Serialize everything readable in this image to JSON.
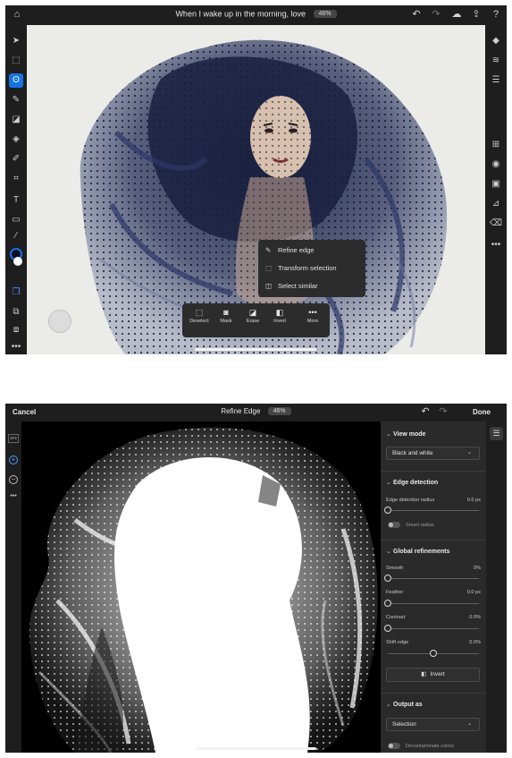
{
  "screen1": {
    "document_title": "When I wake up in the morning, love",
    "zoom": "46%",
    "left_tools": [
      "home-icon",
      "move-icon",
      "transform-icon",
      "lasso-icon",
      "brush-icon",
      "eraser-icon",
      "fill-icon",
      "healing-icon",
      "crop-icon",
      "type-icon",
      "place-image-icon",
      "eyedropper-icon",
      "color-swatch",
      "layers-select-icon",
      "mask-icon",
      "stack-icon",
      "more-icon"
    ],
    "right_tools": [
      "layers-icon",
      "layer-properties-icon",
      "adjustments-icon",
      "add-layer-icon",
      "visibility-icon",
      "mask-icon",
      "adjustment-layer-icon",
      "clear-icon",
      "more-icon"
    ],
    "context_menu": {
      "items": [
        {
          "icon": "refine-edge-icon",
          "label": "Refine edge"
        },
        {
          "icon": "transform-selection-icon",
          "label": "Transform selection"
        },
        {
          "icon": "select-similar-icon",
          "label": "Select similar"
        }
      ]
    },
    "bottom_bar": {
      "items": [
        {
          "icon": "deselect-icon",
          "label": "Deselect"
        },
        {
          "icon": "mask-icon",
          "label": "Mask"
        },
        {
          "icon": "erase-icon",
          "label": "Erase"
        },
        {
          "icon": "invert-icon",
          "label": "Invert"
        },
        {
          "icon": "more-icon",
          "label": "More"
        }
      ]
    }
  },
  "screen2": {
    "cancel_label": "Cancel",
    "title": "Refine Edge",
    "zoom": "46%",
    "done_label": "Done",
    "left_tools": {
      "size_badge": "474"
    },
    "panel": {
      "view_mode": {
        "heading": "View mode",
        "selected": "Black and white"
      },
      "edge_detection": {
        "heading": "Edge detection",
        "radius_label": "Edge detection radius",
        "radius_value": "0.0 px",
        "radius_fraction": 0,
        "smart_radius_label": "Smart radius",
        "smart_radius_on": false
      },
      "global_refinements": {
        "heading": "Global refinements",
        "smooth_label": "Smooth",
        "smooth_value": "0%",
        "smooth_fraction": 0,
        "feather_label": "Feather",
        "feather_value": "0.0 px",
        "feather_fraction": 0,
        "contrast_label": "Contrast",
        "contrast_value": "0.0%",
        "contrast_fraction": 0,
        "shift_edge_label": "Shift edge",
        "shift_edge_value": "0.0%",
        "shift_edge_fraction": 0.5,
        "invert_label": "Invert"
      },
      "output_as": {
        "heading": "Output as",
        "selected": "Selection",
        "decontaminate_label": "Decontaminate colors",
        "decontaminate_on": false
      }
    }
  },
  "colors": {
    "accent": "#1473e6",
    "chrome": "#1e1e1e",
    "panel": "#2a2a2a",
    "veil": "#1c2444"
  }
}
